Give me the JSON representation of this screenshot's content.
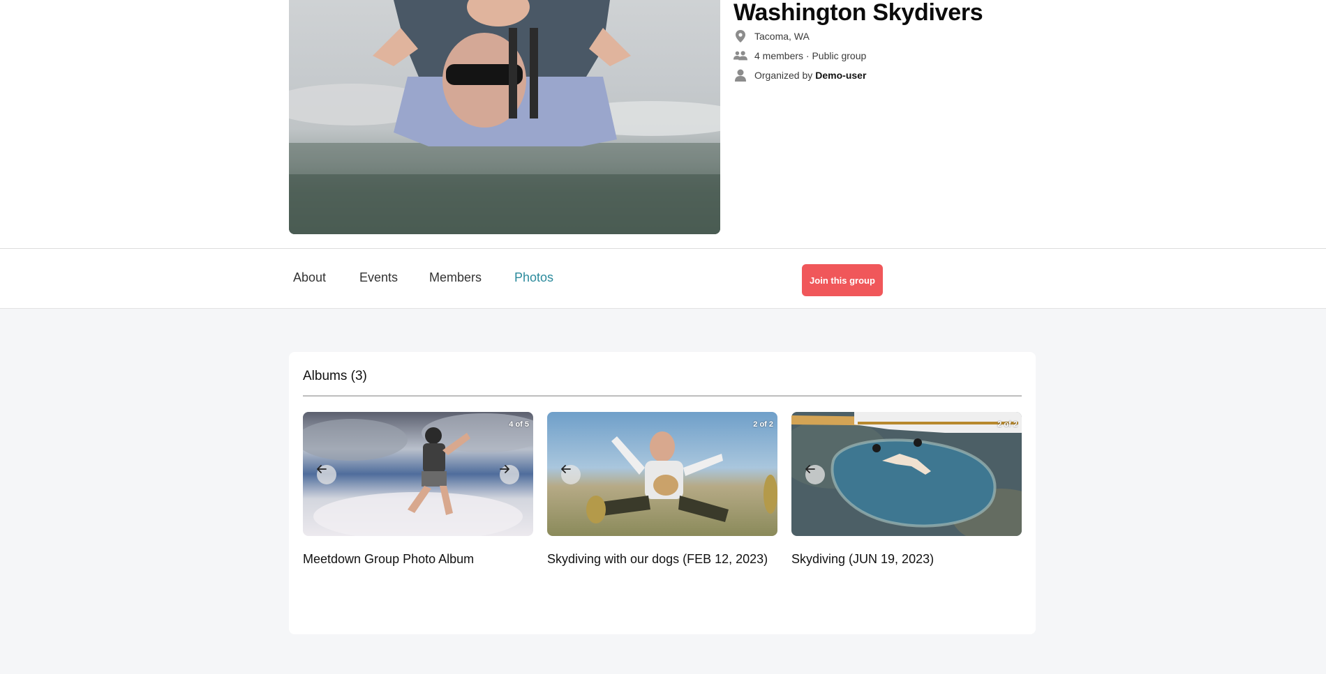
{
  "group": {
    "title": "Washington Skydivers",
    "location": "Tacoma, WA",
    "members_text": "4 members · Public group",
    "organized_prefix": "Organized by",
    "organizer": "Demo-user"
  },
  "tabs": [
    {
      "label": "About",
      "active": false
    },
    {
      "label": "Events",
      "active": false
    },
    {
      "label": "Members",
      "active": false
    },
    {
      "label": "Photos",
      "active": true
    }
  ],
  "join_button": "Join this group",
  "albums": {
    "title": "Albums (3)",
    "items": [
      {
        "name": "Meetdown Group Photo Album",
        "counter": "4 of 5",
        "has_prev": true,
        "has_next": true
      },
      {
        "name": "Skydiving with our dogs (FEB 12, 2023)",
        "counter": "2 of 2",
        "has_prev": true,
        "has_next": false
      },
      {
        "name": "Skydiving (JUN 19, 2023)",
        "counter": "2 of 2",
        "has_prev": true,
        "has_next": false
      }
    ]
  },
  "icons": {
    "location": "map-pin-icon",
    "members": "people-icon",
    "organizer": "person-icon",
    "prev": "arrow-left-icon",
    "next": "arrow-right-icon"
  },
  "colors": {
    "accent_tab": "#2b8a9c",
    "join_button": "#f0575a",
    "content_bg": "#f5f6f8"
  }
}
